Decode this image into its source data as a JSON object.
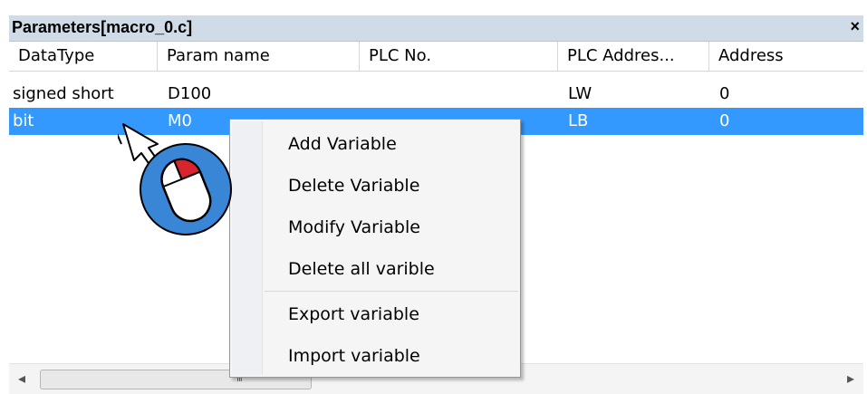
{
  "window": {
    "title": "Parameters[macro_0.c]",
    "close_glyph": "×"
  },
  "table": {
    "columns": [
      "DataType",
      "Param name",
      "PLC No.",
      "PLC Addres...",
      "Address"
    ],
    "rows": [
      [
        "signed short",
        "D100",
        "",
        "LW",
        "0"
      ],
      [
        "bit",
        "M0",
        "",
        "LB",
        "0"
      ]
    ],
    "selected_row": 1
  },
  "context_menu": {
    "items": [
      "Add Variable",
      "Delete Variable",
      "Modify Variable",
      "Delete all varible",
      "Export variable",
      "Import variable"
    ]
  },
  "scrollbar": {
    "left_arrow": "◂",
    "right_arrow": "▸",
    "grip": "III"
  },
  "colors": {
    "selection": "#3399ff",
    "titlebar": "#cfdce8",
    "cursor_circle": "#3a86d6",
    "mouse_button": "#d9232d"
  },
  "icons": [
    "pointer-cursor-icon",
    "mouse-right-click-icon",
    "close-icon"
  ]
}
